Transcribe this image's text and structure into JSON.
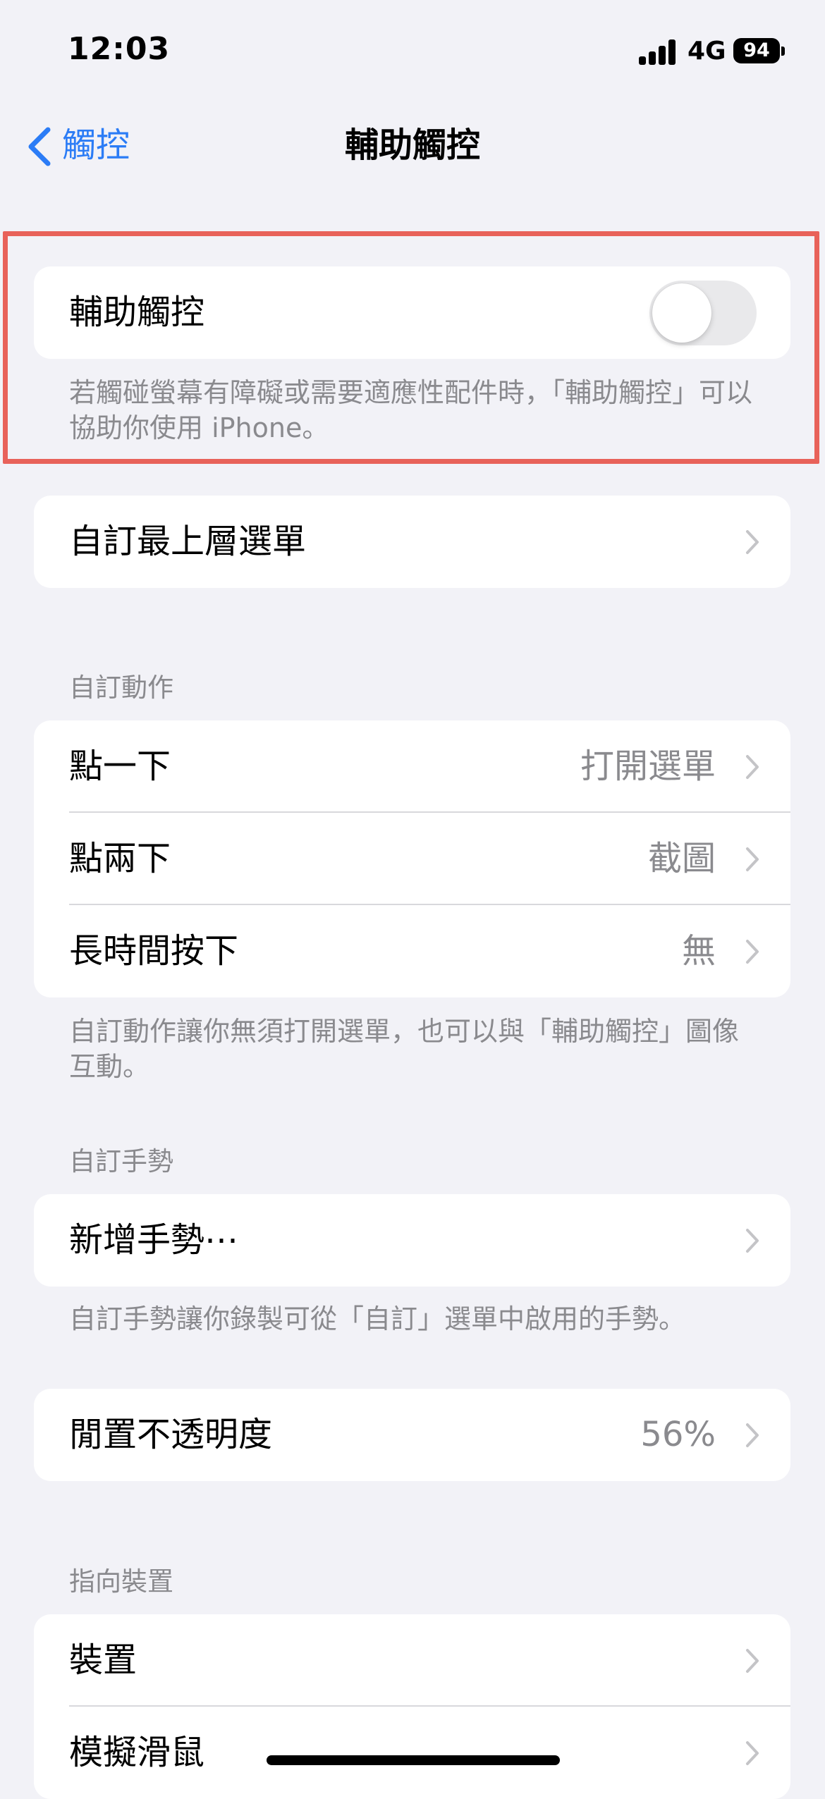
{
  "status_bar": {
    "time": "12:03",
    "network": "4G",
    "battery": "94"
  },
  "nav": {
    "back_label": "觸控",
    "title": "輔助觸控"
  },
  "main_toggle": {
    "label": "輔助觸控",
    "state": "off",
    "footer": "若觸碰螢幕有障礙或需要適應性配件時，「輔助觸控」可以協助你使用 iPhone。"
  },
  "top_menu": {
    "label": "自訂最上層選單"
  },
  "custom_actions": {
    "header": "自訂動作",
    "rows": [
      {
        "label": "點一下",
        "value": "打開選單"
      },
      {
        "label": "點兩下",
        "value": "截圖"
      },
      {
        "label": "長時間按下",
        "value": "無"
      }
    ],
    "footer": "自訂動作讓你無須打開選單，也可以與「輔助觸控」圖像互動。"
  },
  "custom_gestures": {
    "header": "自訂手勢",
    "new_gesture_label": "新增手勢⋯",
    "footer": "自訂手勢讓你錄製可從「自訂」選單中啟用的手勢。"
  },
  "idle_opacity": {
    "label": "閒置不透明度",
    "value": "56%"
  },
  "pointer_devices": {
    "header": "指向裝置",
    "rows": [
      {
        "label": "裝置"
      },
      {
        "label": "模擬滑鼠"
      }
    ]
  },
  "colors": {
    "accent": "#2b7cf6",
    "highlight": "#e8625a",
    "background": "#f2f2f7"
  }
}
